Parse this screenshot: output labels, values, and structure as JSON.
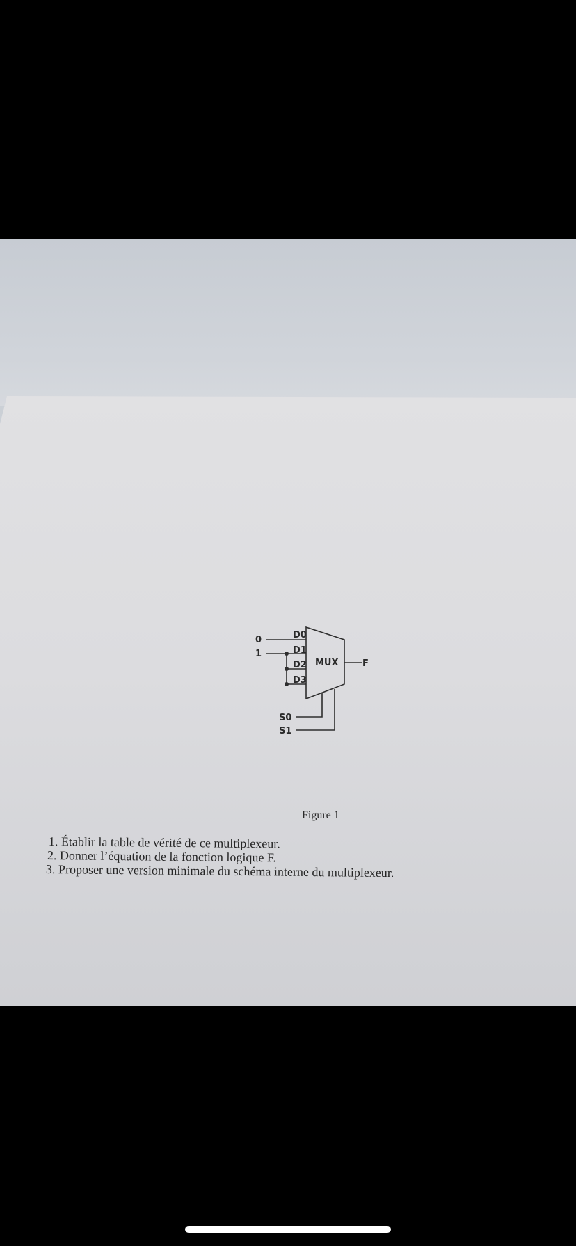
{
  "diagram": {
    "input_values": [
      "0",
      "1"
    ],
    "data_inputs": [
      "D0",
      "D1",
      "D2",
      "D3"
    ],
    "block_label": "MUX",
    "output_label": "F",
    "select_inputs": [
      "S0",
      "S1"
    ]
  },
  "figure_caption": "Figure 1",
  "questions": [
    "1. Établir la table de vérité de ce multiplexeur.",
    "2. Donner l’équation de la fonction logique F.",
    "3. Proposer une version minimale du schéma interne du multiplexeur."
  ]
}
